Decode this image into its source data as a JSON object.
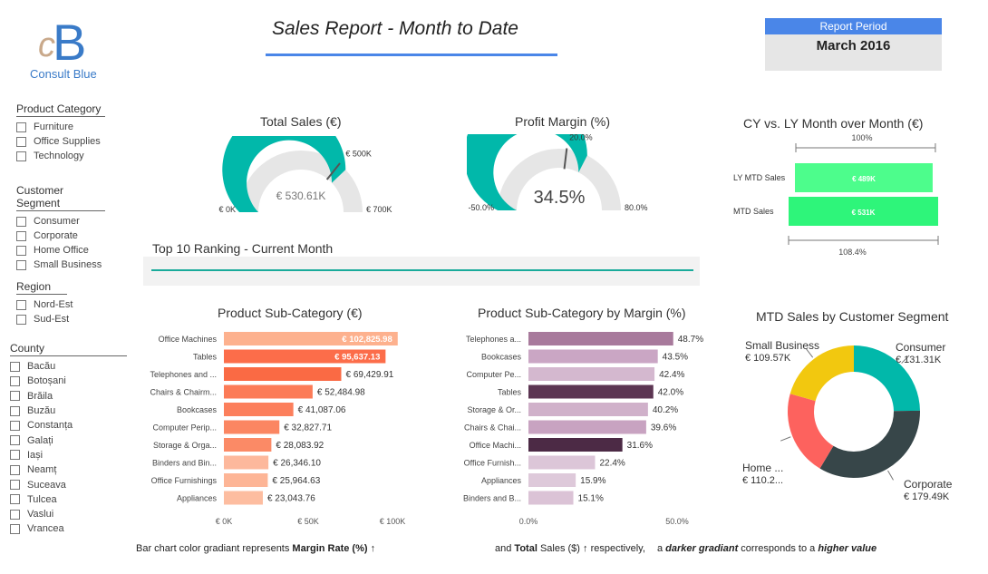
{
  "logo": {
    "letters": "cB",
    "text": "Consult Blue"
  },
  "title": "Sales Report - Month to Date",
  "report_period": {
    "label": "Report Period",
    "value": "March 2016"
  },
  "slicers": {
    "product_category": {
      "title": "Product Category",
      "items": [
        "Furniture",
        "Office Supplies",
        "Technology"
      ]
    },
    "customer_segment": {
      "title": "Customer Segment",
      "items": [
        "Consumer",
        "Corporate",
        "Home Office",
        "Small Business"
      ]
    },
    "region": {
      "title": "Region",
      "items": [
        "Nord-Est",
        "Sud-Est"
      ]
    },
    "county": {
      "title": "County",
      "items": [
        "Bacău",
        "Botoșani",
        "Brăila",
        "Buzău",
        "Constanța",
        "Galați",
        "Iași",
        "Neamț",
        "Suceava",
        "Tulcea",
        "Vaslui",
        "Vrancea"
      ]
    }
  },
  "colors": {
    "accent": "#4a86e8",
    "teal": "#01b8aa",
    "gauge_bg": "#e6e6e6",
    "green_ly": "#4dfd8c",
    "green_mtd": "#2ef57a"
  },
  "total_sales": {
    "title": "Total Sales (€)",
    "value": 530.61,
    "value_label": "€ 530.61K",
    "min": 0,
    "min_label": "€ 0K",
    "max": 700,
    "max_label": "€ 700K",
    "target": 500,
    "target_label": "€ 500K"
  },
  "profit_margin": {
    "title": "Profit Margin (%)",
    "value": 34.5,
    "value_label": "34.5%",
    "min": -50,
    "min_label": "-50.0%",
    "max": 80,
    "max_label": "80.0%",
    "target": 20,
    "target_label": "20.0%"
  },
  "cy_ly": {
    "title": "CY vs. LY Month over Month (€)",
    "top_label": "100%",
    "bottom_label": "108.4%",
    "rows": [
      {
        "name": "LY MTD Sales",
        "value": 489,
        "label": "€ 489K",
        "color": "#4dfd8c"
      },
      {
        "name": "MTD Sales",
        "value": 531,
        "label": "€ 531K",
        "color": "#2ef57a"
      }
    ]
  },
  "ranking_title": "Top 10 Ranking - Current Month",
  "chart_data": [
    {
      "type": "bar",
      "title": "Product Sub-Category (€)",
      "categories": [
        "Office Machines",
        "Tables",
        "Telephones and ...",
        "Chairs & Chairm...",
        "Bookcases",
        "Computer Perip...",
        "Storage & Orga...",
        "Binders and Bin...",
        "Office Furnishings",
        "Appliances"
      ],
      "values": [
        102825.98,
        95637.13,
        69429.91,
        52484.98,
        41087.06,
        32827.71,
        28083.92,
        26346.1,
        25964.63,
        23043.76
      ],
      "labels": [
        "€ 102,825.98",
        "€ 95,637.13",
        "€ 69,429.91",
        "€ 52,484.98",
        "€ 41,087.06",
        "€ 32,827.71",
        "€ 28,083.92",
        "€ 26,346.10",
        "€ 25,964.63",
        "€ 23,043.76"
      ],
      "colors": [
        "#fdb18e",
        "#fc6d4a",
        "#fa6a44",
        "#fc7b57",
        "#fc7f5c",
        "#fb8662",
        "#fb8a66",
        "#fdb89c",
        "#fdb596",
        "#fdbda0"
      ],
      "xlim": [
        0,
        100000
      ],
      "xticks": [
        "€ 0K",
        "€ 50K",
        "€ 100K"
      ]
    },
    {
      "type": "bar",
      "title": "Product Sub-Category by Margin (%)",
      "categories": [
        "Telephones a...",
        "Bookcases",
        "Computer Pe...",
        "Tables",
        "Storage & Or...",
        "Chairs & Chai...",
        "Office Machi...",
        "Office Furnish...",
        "Appliances",
        "Binders and B..."
      ],
      "values": [
        48.7,
        43.5,
        42.4,
        42.0,
        40.2,
        39.6,
        31.6,
        22.4,
        15.9,
        15.1
      ],
      "labels": [
        "48.7%",
        "43.5%",
        "42.4%",
        "42.0%",
        "40.2%",
        "39.6%",
        "31.6%",
        "22.4%",
        "15.9%",
        "15.1%"
      ],
      "colors": [
        "#a87a9c",
        "#caa6c4",
        "#d4b8cf",
        "#5c3552",
        "#d0b1ca",
        "#c8a3c1",
        "#4c2a45",
        "#dcc6d8",
        "#dec9da",
        "#dbc3d6"
      ],
      "xlim": [
        0,
        50
      ],
      "xticks": [
        "0.0%",
        "50.0%"
      ]
    },
    {
      "type": "pie",
      "title": "MTD Sales by Customer Segment",
      "categories": [
        "Consumer",
        "Corporate",
        "Home ...",
        "Small Business"
      ],
      "values": [
        131.31,
        179.49,
        110.2,
        109.57
      ],
      "labels": [
        "€ 131.31K",
        "€ 179.49K",
        "€ 110.2...",
        "€ 109.57K"
      ],
      "colors": [
        "#01b8aa",
        "#374649",
        "#fd625e",
        "#f2c80f"
      ]
    }
  ],
  "footer": {
    "part1": "Bar chart color gradiant represents ",
    "bold1": "Margin Rate (%) ↑",
    "part2": "and ",
    "bold2": "Total",
    "part3": " Sales ($) ↑ respectively,",
    "part4": "a ",
    "bolditalic1": "darker gradiant",
    "part5": " corresponds to a ",
    "bolditalic2": "higher value"
  }
}
